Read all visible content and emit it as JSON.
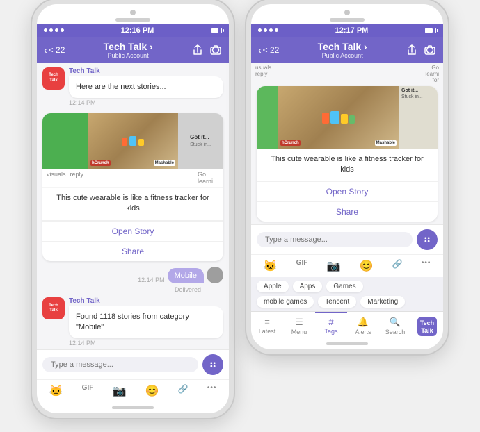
{
  "phone1": {
    "status_bar": {
      "dots": 4,
      "time": "12:16 PM",
      "signal": "●●●"
    },
    "nav": {
      "back_label": "< 22",
      "title": "Tech Talk ›",
      "subtitle": "Public Account",
      "icon1": "↑",
      "icon2": "⊙"
    },
    "messages": [
      {
        "sender": "Tech Talk",
        "avatar_text": "Tech\nTalk",
        "text": "Here are the next stories...",
        "time": "12:14 PM"
      }
    ],
    "card": {
      "title": "This cute wearable is like a fitness tracker for kids",
      "open_story_label": "Open Story",
      "share_label": "Share",
      "brand1": "hCrunch",
      "brand2": "Mashable"
    },
    "own_message": {
      "text": "Mobile",
      "time": "12:14 PM",
      "delivered": "Delivered"
    },
    "second_message": {
      "sender": "Tech Talk",
      "avatar_text": "Tech\nTalk",
      "text": "Found 1118 stories from category \"Mobile\"",
      "time": "12:14 PM"
    },
    "input": {
      "placeholder": "Type a message..."
    },
    "bottom_icons": [
      "🐱",
      "GIF",
      "📷",
      "😊",
      "🔗",
      "•••"
    ]
  },
  "phone2": {
    "status_bar": {
      "time": "12:17 PM"
    },
    "nav": {
      "back_label": "< 22",
      "title": "Tech Talk ›",
      "subtitle": "Public Account",
      "icon1": "↑",
      "icon2": "⊙"
    },
    "card": {
      "title": "This cute wearable is like a fitness tracker for kids",
      "open_story_label": "Open Story",
      "share_label": "Share"
    },
    "input": {
      "placeholder": "Type a message..."
    },
    "bottom_icons": [
      "🐱",
      "GIF",
      "📷",
      "😊",
      "🔗",
      "•••"
    ],
    "emoji_suggestions_row1": [
      "Apple",
      "Apps",
      "Games"
    ],
    "emoji_suggestions_row2": [
      "mobile games",
      "Tencent",
      "Marketing"
    ],
    "tab_bar": [
      {
        "label": "Latest",
        "active": false
      },
      {
        "label": "Menu",
        "active": false
      },
      {
        "label": "Tags",
        "active": true
      },
      {
        "label": "Alerts",
        "active": false
      },
      {
        "label": "Search",
        "active": false
      },
      {
        "label": "Tech\nTalk",
        "active": false,
        "special": true
      }
    ],
    "side_cards": {
      "got_it": "Got it...",
      "stuck": "Stuck in...",
      "go": "Go\nlearni\nfor"
    }
  }
}
